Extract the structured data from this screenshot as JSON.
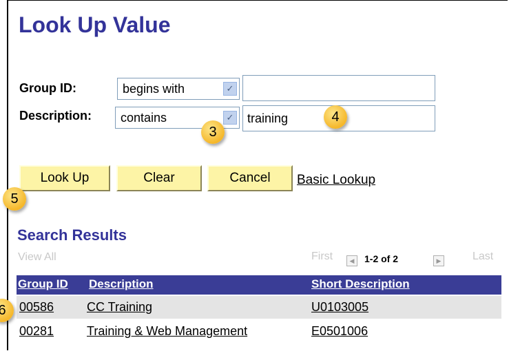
{
  "page": {
    "title": "Look Up Value"
  },
  "criteria": {
    "group_id": {
      "label": "Group ID:",
      "operator": "begins with",
      "value": ""
    },
    "description": {
      "label": "Description:",
      "operator": "contains",
      "value": "training"
    }
  },
  "buttons": {
    "look_up": "Look Up",
    "clear": "Clear",
    "cancel": "Cancel",
    "basic_lookup": "Basic Lookup"
  },
  "results": {
    "title": "Search Results",
    "view_all": "View All",
    "pager": {
      "first": "First",
      "count": "1-2 of 2",
      "last": "Last"
    },
    "columns": [
      "Group ID",
      "Description",
      "Short Description"
    ],
    "rows": [
      {
        "group_id": "00586",
        "description": "CC Training",
        "short_description": "U0103005"
      },
      {
        "group_id": "00281",
        "description": "Training & Web Management",
        "short_description": "E0501006"
      }
    ]
  },
  "callouts": [
    "3",
    "4",
    "5",
    "6"
  ],
  "colors": {
    "title": "#333399",
    "header_bg": "#3a3d96",
    "button_bg": "#fdf4a6",
    "callout": "#f5b72a",
    "row_alt": "#e4e4e4"
  }
}
